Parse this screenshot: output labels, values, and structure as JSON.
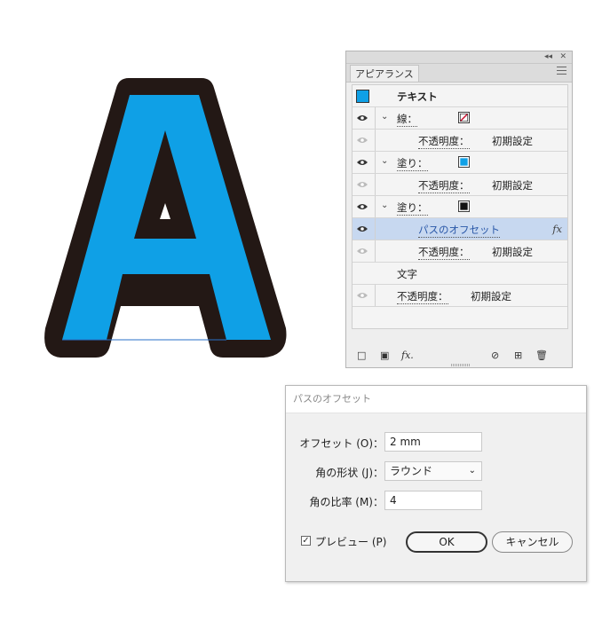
{
  "colors": {
    "fill_blue": "#0fa0e6",
    "stroke_dark": "#231815",
    "selection_blue": "#c7d8f0",
    "stroke_swatch_red": "#c8102e"
  },
  "panel": {
    "tab_label": "アピアランス",
    "top_buttons": [
      "◂◂",
      "✕"
    ],
    "header_label": "テキスト",
    "rows": [
      {
        "kind": "stroke",
        "label": "線：",
        "chevron": "⌄"
      },
      {
        "kind": "opacity",
        "label": "不透明度：",
        "value": "初期設定"
      },
      {
        "kind": "fill",
        "label": "塗り：",
        "chevron": "⌄"
      },
      {
        "kind": "opacity",
        "label": "不透明度：",
        "value": "初期設定"
      },
      {
        "kind": "fill",
        "label": "塗り：",
        "chevron": "⌄"
      },
      {
        "kind": "effect",
        "label": "パスのオフセット",
        "fx": "fx"
      },
      {
        "kind": "opacity",
        "label": "不透明度：",
        "value": "初期設定"
      },
      {
        "kind": "text",
        "label": "文字"
      },
      {
        "kind": "opacity",
        "label": "不透明度：",
        "value": "初期設定"
      }
    ],
    "bottom_icons": [
      "□",
      "▣",
      "fx.",
      "⊘",
      "⊞",
      "🗑"
    ]
  },
  "dialog": {
    "title": "パスのオフセット",
    "offset_label": "オフセット (O)：",
    "offset_value": "2 mm",
    "corner_label": "角の形状 (J)：",
    "corner_value": "ラウンド",
    "caret": "⌄",
    "ratio_label": "角の比率 (M)：",
    "ratio_value": "4",
    "check_mark": "✓",
    "preview_label": "プレビュー (P)",
    "ok_label": "OK",
    "cancel_label": "キャンセル"
  }
}
